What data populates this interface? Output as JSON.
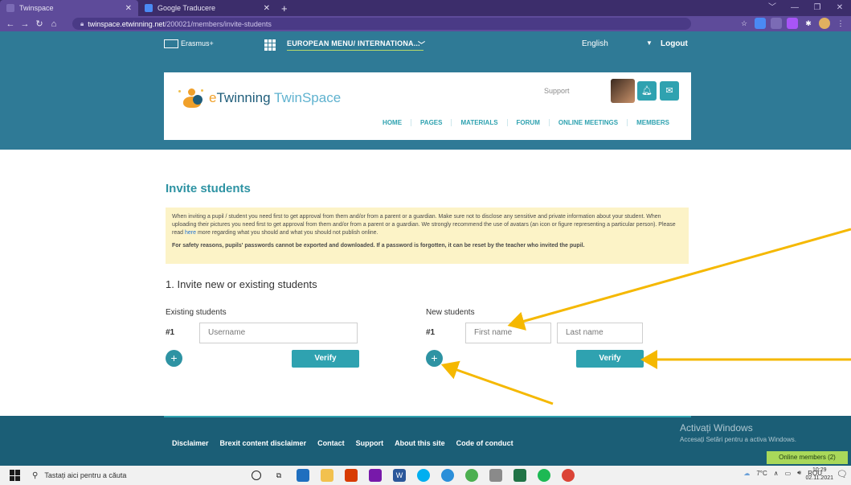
{
  "browser": {
    "tabs": [
      {
        "label": "Twinspace",
        "active": true
      },
      {
        "label": "Google Traducere",
        "active": false
      }
    ],
    "url_host": "twinspace.etwinning.net",
    "url_path": "/200021/members/invite-students"
  },
  "topbar": {
    "erasmus": "Erasmus+",
    "european_menu": "EUROPEAN MENU/ INTERNATIONA...",
    "language": "English",
    "logout": "Logout"
  },
  "header": {
    "brand_e": "e",
    "brand_twinning": "Twinning",
    "brand_twinspace": "TwinSpace",
    "support": "Support",
    "nav": [
      "HOME",
      "PAGES",
      "MATERIALS",
      "FORUM",
      "ONLINE MEETINGS",
      "MEMBERS"
    ]
  },
  "page": {
    "title": "Invite students",
    "notice_1": "When inviting a pupil / student you need first to get approval from them and/or from a parent or a guardian. Make sure not to disclose any sensitive and private information about your student. When uploading their pictures you need first to get approval from them and/or from a parent or a guardian. We strongly recommend the use of avatars (an icon or figure representing a particular person). Please read",
    "notice_link": "here",
    "notice_2": "more regarding what you should and what you should not publish online.",
    "notice_bold": "For safety reasons, pupils' passwords cannot be exported and downloaded. If a password is forgotten, it can be reset by the teacher who invited the pupil.",
    "section_title": "1. Invite new or existing students",
    "existing_label": "Existing students",
    "new_label": "New students",
    "row_num": "#1",
    "username_placeholder": "Username",
    "first_name_placeholder": "First name",
    "last_name_placeholder": "Last name",
    "verify": "Verify",
    "plus": "+"
  },
  "footer": {
    "links": [
      "Disclaimer",
      "Brexit content disclaimer",
      "Contact",
      "Support",
      "About this site",
      "Code of conduct"
    ],
    "activate_title": "Activați Windows",
    "activate_sub": "Accesați Setări pentru a activa Windows.",
    "online_members": "Online members (2)"
  },
  "taskbar": {
    "search": "Tastați aici pentru a căuta",
    "temperature": "7°C",
    "lang": "ROU",
    "time": "10:29",
    "date": "02.11.2021"
  },
  "colors": {
    "teal": "#2f7a96",
    "accent": "#2fa2b0",
    "arrow": "#f5b800",
    "notice": "#fcf3c7"
  }
}
